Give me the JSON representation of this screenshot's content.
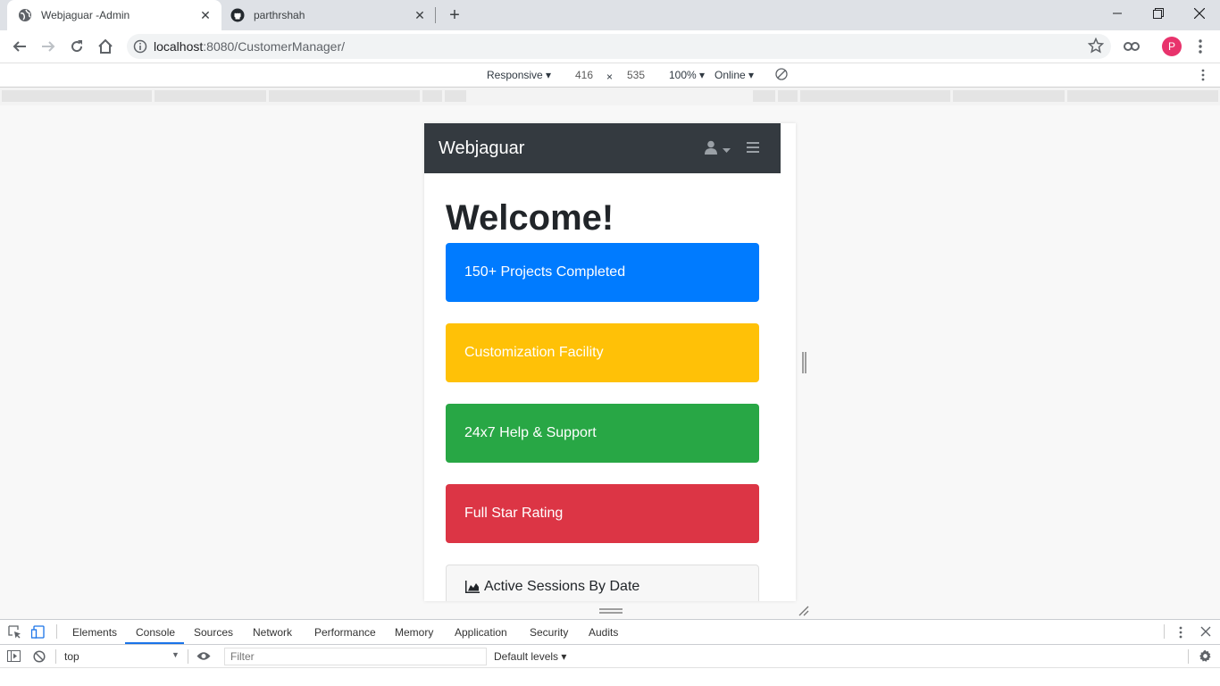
{
  "browser": {
    "tabs": [
      {
        "title": "Webjaguar -Admin",
        "active": true
      },
      {
        "title": "parthrshah",
        "active": false
      }
    ],
    "url_host": "localhost",
    "url_rest": ":8080/CustomerManager/",
    "profile_initial": "P"
  },
  "device_toolbar": {
    "mode": "Responsive ▾",
    "width": "416",
    "times": "×",
    "height": "535",
    "zoom": "100% ▾",
    "network": "Online ▾"
  },
  "page": {
    "brand": "Webjaguar",
    "heading": "Welcome!",
    "cards": [
      {
        "label": "150+ Projects Completed",
        "color": "#007bff"
      },
      {
        "label": "Customization Facility",
        "color": "#ffc107"
      },
      {
        "label": "24x7 Help & Support",
        "color": "#28a745"
      },
      {
        "label": "Full Star Rating",
        "color": "#dc3545"
      }
    ],
    "sessions_card": "Active Sessions By Date"
  },
  "devtools": {
    "tabs": [
      "Elements",
      "Console",
      "Sources",
      "Network",
      "Performance",
      "Memory",
      "Application",
      "Security",
      "Audits"
    ],
    "active_tab": "Console",
    "context": "top",
    "filter_placeholder": "Filter",
    "levels": "Default levels ▾"
  }
}
